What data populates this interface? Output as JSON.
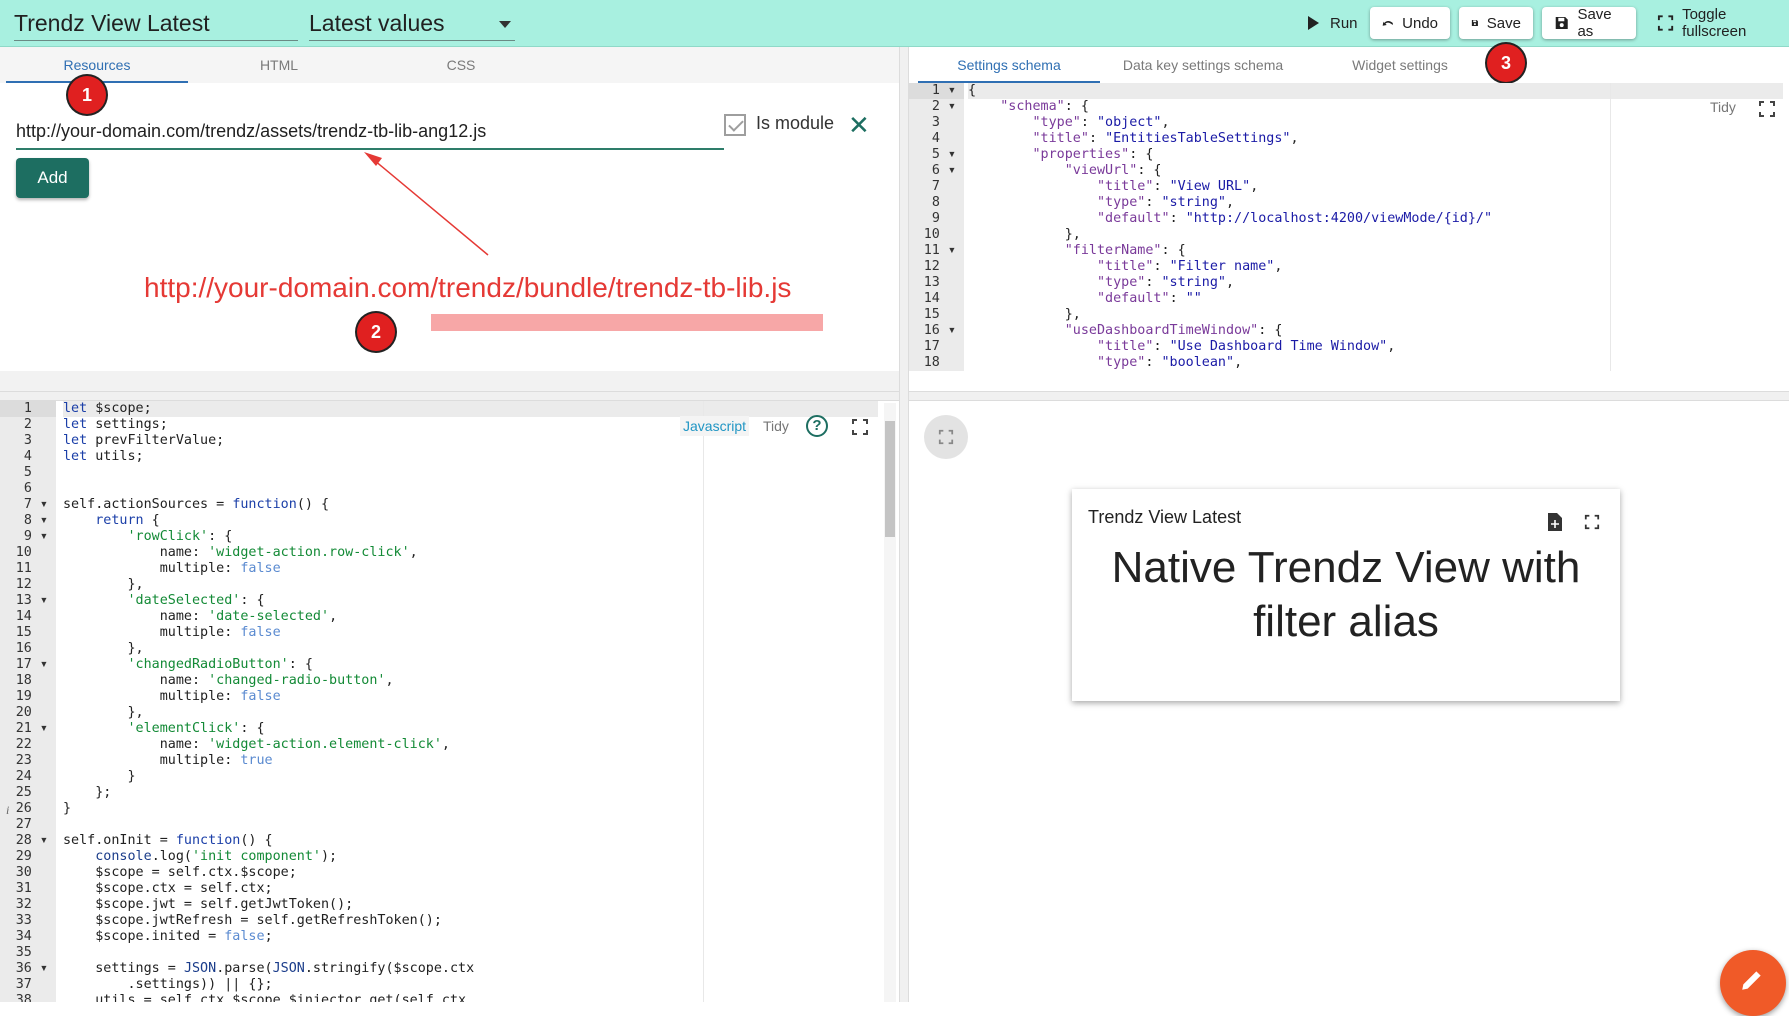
{
  "header": {
    "widget_title": "Trendz View Latest",
    "widget_type": "Latest values",
    "buttons": {
      "run": "Run",
      "undo": "Undo",
      "save": "Save",
      "save_as": "Save as",
      "toggle_fullscreen": "Toggle fullscreen"
    }
  },
  "left_tabs": [
    "Resources",
    "HTML",
    "CSS"
  ],
  "resources": {
    "url": "http://your-domain.com/trendz/assets/trendz-tb-lib-ang12.js",
    "is_module_label": "Is module",
    "add_label": "Add"
  },
  "annotations": {
    "badge_1": "1",
    "badge_2": "2",
    "badge_3": "3",
    "correct_url": "http://your-domain.com/trendz/bundle/trendz-tb-lib.js",
    "colors": {
      "annotation": "#e53935",
      "badge": "#e02020"
    }
  },
  "right_tabs": [
    "Settings schema",
    "Data key settings schema",
    "Widget settings"
  ],
  "schema_editor": {
    "tidy_label": "Tidy",
    "lines": [
      "{",
      "    \"schema\": {",
      "        \"type\": \"object\",",
      "        \"title\": \"EntitiesTableSettings\",",
      "        \"properties\": {",
      "            \"viewUrl\": {",
      "                \"title\": \"View URL\",",
      "                \"type\": \"string\",",
      "                \"default\": \"http://localhost:4200/viewMode/{id}/\"",
      "            },",
      "            \"filterName\": {",
      "                \"title\": \"Filter name\",",
      "                \"type\": \"string\",",
      "                \"default\": \"\"",
      "            },",
      "            \"useDashboardTimeWindow\": {",
      "                \"title\": \"Use Dashboard Time Window\",",
      "                \"type\": \"boolean\","
    ]
  },
  "js_editor": {
    "mode_label": "Javascript",
    "tidy_label": "Tidy",
    "lines": [
      "let $scope;",
      "let settings;",
      "let prevFilterValue;",
      "let utils;",
      "",
      "",
      "self.actionSources = function() {",
      "    return {",
      "        'rowClick': {",
      "            name: 'widget-action.row-click',",
      "            multiple: false",
      "        },",
      "        'dateSelected': {",
      "            name: 'date-selected',",
      "            multiple: false",
      "        },",
      "        'changedRadioButton': {",
      "            name: 'changed-radio-button',",
      "            multiple: false",
      "        },",
      "        'elementClick': {",
      "            name: 'widget-action.element-click',",
      "            multiple: true",
      "        }",
      "    };",
      "}",
      "",
      "self.onInit = function() {",
      "    console.log('init component');",
      "    $scope = self.ctx.$scope;",
      "    $scope.ctx = self.ctx;",
      "    $scope.jwt = self.getJwtToken();",
      "    $scope.jwtRefresh = self.getRefreshToken();",
      "    $scope.inited = false;",
      "",
      "    settings = JSON.parse(JSON.stringify($scope.ctx",
      "        .settings)) || {};",
      "    utils = self.ctx.$scope.$injector.get(self.ctx"
    ]
  },
  "preview": {
    "widget_title": "Trendz View Latest",
    "widget_text": "Native Trendz View with filter alias"
  }
}
